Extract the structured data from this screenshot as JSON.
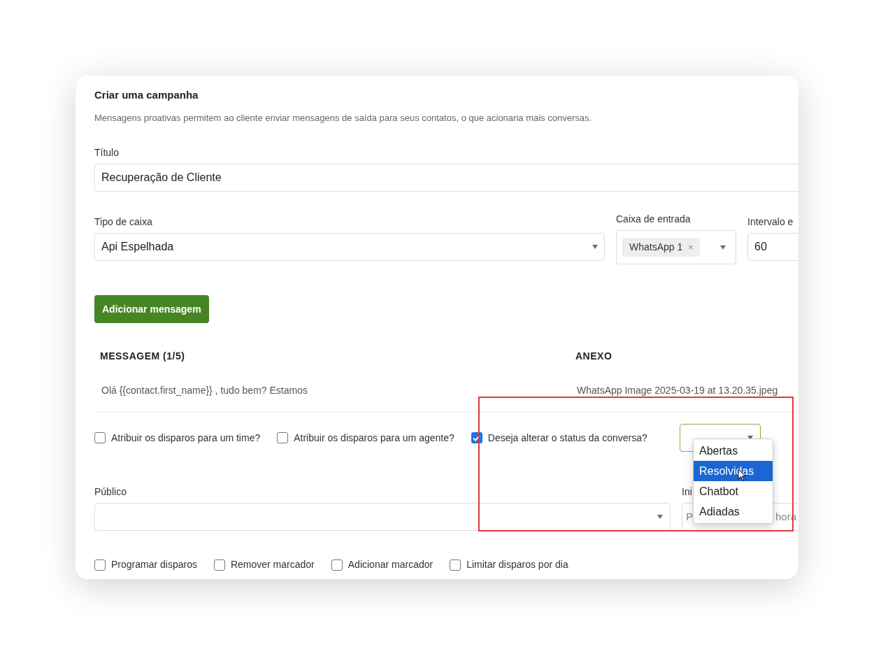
{
  "header": {
    "title": "Criar uma campanha",
    "description": "Mensagens proativas permitem ao cliente enviar mensagens de saída para seus contatos, o que acionaria mais conversas."
  },
  "title_field": {
    "label": "Título",
    "value": "Recuperação de Cliente"
  },
  "inbox_type": {
    "label": "Tipo de caixa",
    "value": "Api Espelhada"
  },
  "inbox": {
    "label": "Caixa de entrada",
    "tags": [
      "WhatsApp 1"
    ],
    "remove_mark": "×"
  },
  "interval": {
    "label": "Intervalo e",
    "value": "60"
  },
  "add_button": "Adicionar mensagem",
  "table": {
    "columns": [
      "MESSAGEM (1/5)",
      "ANEXO"
    ],
    "rows": [
      [
        "Olá {{contact.first_name}} , tudo bem? Estamos",
        "WhatsApp Image 2025-03-19 at 13.20.35.jpeg"
      ]
    ]
  },
  "options": [
    {
      "label": "Atribuir os disparos para um time?",
      "checked": false
    },
    {
      "label": "Atribuir os disparos para um agente?",
      "checked": false
    },
    {
      "label": "Deseja alterar o status da conversa?",
      "checked": true
    }
  ],
  "status_menu": [
    {
      "label": "Abertas",
      "selected": false
    },
    {
      "label": "Resolvidas",
      "selected": true
    },
    {
      "label": "Chatbot",
      "selected": false
    },
    {
      "label": "Adiadas",
      "selected": false
    }
  ],
  "audience": {
    "label": "Público"
  },
  "start": {
    "label": "Ini",
    "placeholder_start": "P",
    "placeholder_end": "hora"
  },
  "bottom_options": [
    {
      "label": "Programar disparos",
      "checked": false
    },
    {
      "label": "Remover marcador",
      "checked": false
    },
    {
      "label": "Adicionar marcador",
      "checked": false
    },
    {
      "label": "Limitar disparos por dia",
      "checked": false
    }
  ]
}
